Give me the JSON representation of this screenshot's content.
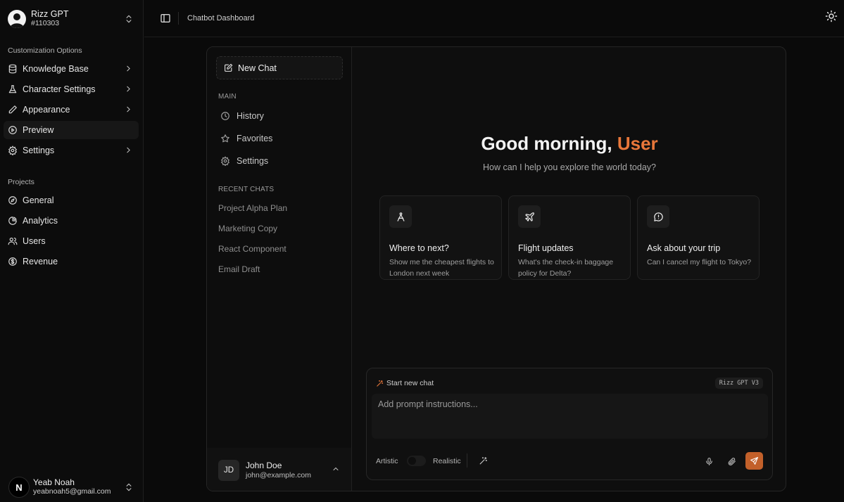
{
  "app": {
    "name": "Rizz GPT",
    "id": "#110303"
  },
  "sidebar": {
    "customization_label": "Customization Options",
    "customization_items": [
      {
        "label": "Knowledge Base",
        "icon": "database-icon",
        "has_submenu": true
      },
      {
        "label": "Character Settings",
        "icon": "flask-icon",
        "has_submenu": true
      },
      {
        "label": "Appearance",
        "icon": "pen-icon",
        "has_submenu": true
      },
      {
        "label": "Preview",
        "icon": "play-circle-icon",
        "has_submenu": false,
        "active": true
      },
      {
        "label": "Settings",
        "icon": "gear-icon",
        "has_submenu": true
      }
    ],
    "projects_label": "Projects",
    "project_items": [
      {
        "label": "General",
        "icon": "compass-icon"
      },
      {
        "label": "Analytics",
        "icon": "pie-chart-icon"
      },
      {
        "label": "Users",
        "icon": "users-icon"
      },
      {
        "label": "Revenue",
        "icon": "dollar-circle-icon"
      }
    ],
    "user": {
      "initial": "N",
      "name": "Yeab Noah",
      "email": "yeabnoah5@gmail.com"
    }
  },
  "topbar": {
    "breadcrumb": "Chatbot Dashboard"
  },
  "chat_sidebar": {
    "new_chat_label": "New Chat",
    "main_label": "MAIN",
    "main_items": [
      {
        "label": "History",
        "icon": "clock-icon"
      },
      {
        "label": "Favorites",
        "icon": "star-icon"
      },
      {
        "label": "Settings",
        "icon": "gear-icon"
      }
    ],
    "recent_label": "RECENT CHATS",
    "recent_items": [
      "Project Alpha Plan",
      "Marketing Copy",
      "React Component",
      "Email Draft"
    ],
    "profile": {
      "initials": "JD",
      "name": "John Doe",
      "email": "john@example.com"
    }
  },
  "main": {
    "greeting_prefix": "Good morning, ",
    "greeting_name": "User",
    "subtitle": "How can I help you explore the world today?",
    "suggestions": [
      {
        "title": "Where to next?",
        "desc": "Show me the cheapest flights to London next week",
        "icon": "compass-drafting-icon"
      },
      {
        "title": "Flight updates",
        "desc": "What's the check-in baggage policy for Delta?",
        "icon": "plane-icon"
      },
      {
        "title": "Ask about your trip",
        "desc": "Can I cancel my flight to Tokyo?",
        "icon": "message-alert-icon"
      }
    ]
  },
  "composer": {
    "header_label": "Start new chat",
    "model_badge": "Rizz GPT V3",
    "placeholder": "Add prompt instructions...",
    "mode_left": "Artistic",
    "mode_right": "Realistic"
  },
  "colors": {
    "accent": "#e8773a",
    "send_button": "#c2602a",
    "background": "#0a0a0a"
  }
}
